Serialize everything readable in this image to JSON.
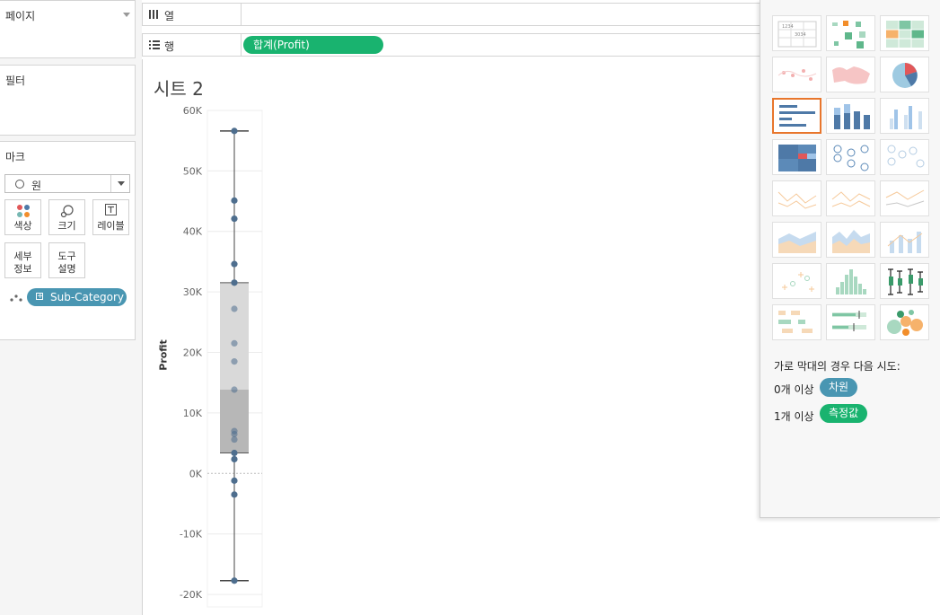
{
  "left_panel": {
    "pages_title": "페이지",
    "filters_title": "필터",
    "marks_title": "마크",
    "mark_type": "원",
    "buttons": {
      "color": "색상",
      "size": "크기",
      "label": "레이블",
      "detail_l1": "세부",
      "detail_l2": "정보",
      "tooltip_l1": "도구",
      "tooltip_l2": "설명"
    },
    "detail_pill": "Sub-Category"
  },
  "shelves": {
    "columns_label": "열",
    "rows_label": "행",
    "rows_pill": "합계(Profit)"
  },
  "sheet": {
    "title": "시트 2"
  },
  "chart_data": {
    "type": "box-plot",
    "ylabel": "Profit",
    "ylim": [
      -21000,
      60000
    ],
    "yticks": [
      "60K",
      "50K",
      "40K",
      "30K",
      "20K",
      "10K",
      "0K",
      "-10K",
      "-20K"
    ],
    "yticks_values": [
      60000,
      50000,
      40000,
      30000,
      20000,
      10000,
      0,
      -10000,
      -20000
    ],
    "box": {
      "whisker_low": -17725,
      "q1": 3384,
      "median": 13844,
      "q3": 31525,
      "whisker_high": 56600
    },
    "points": [
      56600,
      45100,
      42100,
      34600,
      31525,
      27200,
      21500,
      18500,
      13844,
      7000,
      6500,
      5600,
      3384,
      2350,
      -1200,
      -3500,
      -17725
    ],
    "colors": {
      "box_upper": "#d9d9d9",
      "box_lower": "#b7b7b7",
      "point": "#4e6e8e",
      "whisker": "#444444"
    }
  },
  "show_me": {
    "selected_index": 6,
    "hint_title": "가로 막대의 경우 다음 시도:",
    "dimension_req": "0개 이상",
    "dimension_pill": "차원",
    "measure_req": "1개 이상",
    "measure_pill": "측정값",
    "colors": {
      "dimension": "#4996b2",
      "measure": "#19b36f",
      "selected_border": "#e8762c"
    }
  }
}
